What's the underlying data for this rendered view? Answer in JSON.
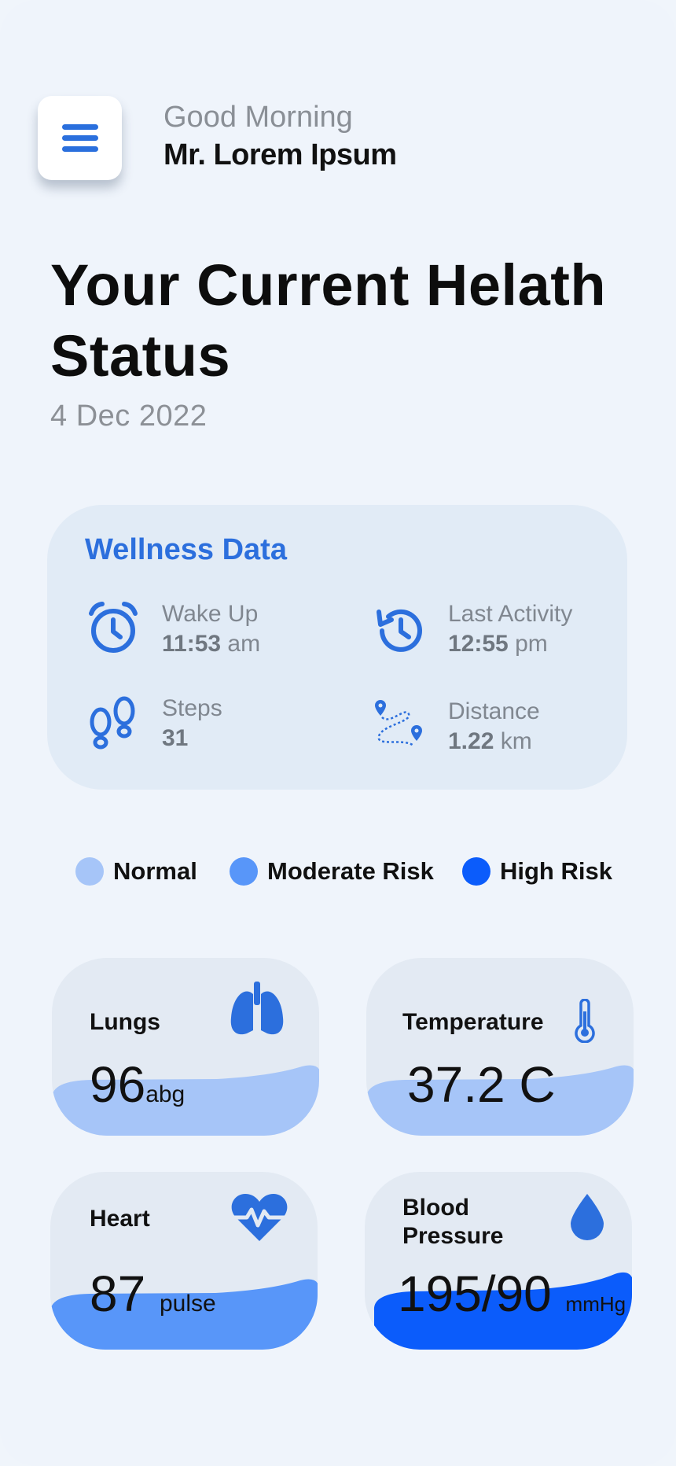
{
  "header": {
    "greeting": "Good Morning",
    "user_name": "Mr. Lorem Ipsum",
    "menu_icon": "hamburger-menu-icon"
  },
  "page": {
    "title": "Your Current Helath Status",
    "date": "4 Dec 2022"
  },
  "wellness": {
    "title": "Wellness Data",
    "items": [
      {
        "label": "Wake Up",
        "value": "11:53",
        "unit": "am",
        "icon": "alarm-clock-icon"
      },
      {
        "label": "Last Activity",
        "value": "12:55",
        "unit": "pm",
        "icon": "history-icon"
      },
      {
        "label": "Steps",
        "value": "31",
        "unit": "",
        "icon": "footsteps-icon"
      },
      {
        "label": "Distance",
        "value": "1.22",
        "unit": "km",
        "icon": "route-icon"
      }
    ]
  },
  "legend": [
    {
      "label": "Normal",
      "color": "#a6c5f8"
    },
    {
      "label": "Moderate Risk",
      "color": "#5896f9"
    },
    {
      "label": "High Risk",
      "color": "#0b5cfb"
    }
  ],
  "cards": [
    {
      "name": "Lungs",
      "value": "96",
      "unit": "abg",
      "status": "Normal",
      "color": "#a6c5f8",
      "icon": "lungs-icon"
    },
    {
      "name": "Temperature",
      "value": "37.2 C",
      "unit": "",
      "status": "Normal",
      "color": "#a6c5f8",
      "icon": "thermometer-icon"
    },
    {
      "name": "Heart",
      "value": "87",
      "unit": "pulse",
      "status": "Moderate Risk",
      "color": "#5896f9",
      "icon": "heart-pulse-icon"
    },
    {
      "name": "Blood\nPressure",
      "value": "195/90",
      "unit": "mmHg",
      "status": "High Risk",
      "color": "#0b5cfb",
      "icon": "blood-drop-icon"
    }
  ],
  "colors": {
    "accent": "#2c6fdd",
    "background": "#eff4fb",
    "card": "#e3eaf3"
  }
}
